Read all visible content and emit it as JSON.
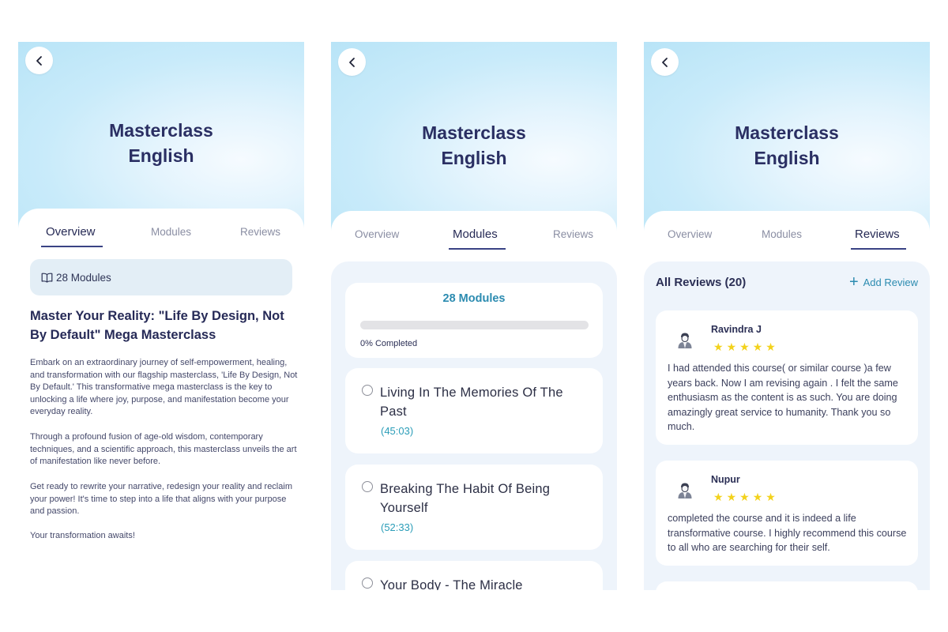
{
  "course": {
    "title_line1": "Masterclass",
    "title_line2": "English"
  },
  "tabs": [
    "Overview",
    "Modules",
    "Reviews"
  ],
  "icons": {
    "back": "chevron-left-icon",
    "book": "book-open-icon",
    "radio": "radio-empty-icon",
    "avatar": "user-avatar-icon",
    "add": "plus-icon",
    "star": "star-icon"
  },
  "colors": {
    "accent": "#2b8bb0",
    "title": "#2a2f63",
    "star": "#f3d21c",
    "panel": "#eef4fb"
  },
  "overview": {
    "modules_count": "28 Modules",
    "heading": "Master Your Reality: \"Life By Design, Not By Default\" Mega Masterclass",
    "paragraphs": [
      "Embark on an extraordinary journey of self-empowerment, healing, and transformation with our flagship masterclass, 'Life By Design, Not By Default.' This transformative mega masterclass is the key to unlocking a life where joy, purpose, and manifestation become your everyday reality.",
      "Through a profound fusion of age-old wisdom, contemporary techniques, and a scientific approach, this masterclass unveils the art of manifestation like never before.",
      "Get ready to rewrite your narrative, redesign your reality and reclaim your power! It's time to step into a life that aligns with your purpose and passion.",
      "Your transformation awaits!"
    ]
  },
  "modules": {
    "count_label": "28 Modules",
    "progress_percent": 0,
    "progress_label": "0% Completed",
    "items": [
      {
        "title": "Living In The Memories Of The Past",
        "duration": "(45:03)"
      },
      {
        "title": "Breaking The Habit Of Being Yourself",
        "duration": "(52:33)"
      },
      {
        "title": "Your Body - The Miracle",
        "duration": ""
      }
    ]
  },
  "reviews": {
    "heading": "All Reviews (20)",
    "add_label": "Add Review",
    "items": [
      {
        "name": "Ravindra J",
        "stars": 5,
        "text": "I had attended this course( or similar course )a few years back. Now I am revising again . I felt the same enthusiasm as the content is as such. You are doing amazingly great service to humanity. Thank you so much."
      },
      {
        "name": "Nupur",
        "stars": 5,
        "text": "completed the course and it is indeed a life transformative course. I highly recommend this course to all who are searching for their self."
      }
    ]
  }
}
